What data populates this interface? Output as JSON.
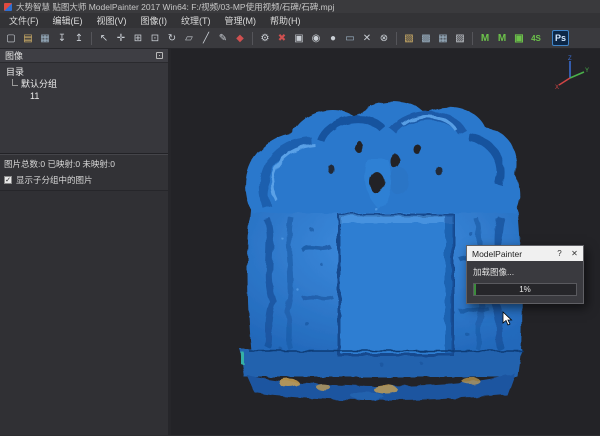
{
  "window": {
    "title": "大势智慧 贴图大师 ModelPainter 2017 Win64: F:/视频/03-MP使用视频/石碑/石碑.mpj"
  },
  "menu": {
    "items": [
      {
        "label": "文件(F)"
      },
      {
        "label": "编辑(E)"
      },
      {
        "label": "视图(V)"
      },
      {
        "label": "图像(I)"
      },
      {
        "label": "纹理(T)"
      },
      {
        "label": "管理(M)"
      },
      {
        "label": "帮助(H)"
      }
    ]
  },
  "toolbar": {
    "icons": [
      {
        "name": "new-file-icon",
        "glyph": "▢"
      },
      {
        "name": "open-folder-icon",
        "glyph": "▤"
      },
      {
        "name": "save-icon",
        "glyph": "▦"
      },
      {
        "name": "import-image-icon",
        "glyph": "↧"
      },
      {
        "name": "export-image-icon",
        "glyph": "↥"
      },
      {
        "name": "select-arrow-icon",
        "glyph": "↖"
      },
      {
        "name": "pan-icon",
        "glyph": "✛"
      },
      {
        "name": "zoom-window-icon",
        "glyph": "⊞"
      },
      {
        "name": "zoom-fit-icon",
        "glyph": "⊡"
      },
      {
        "name": "rotate-view-icon",
        "glyph": "↻"
      },
      {
        "name": "region-select-icon",
        "glyph": "▱"
      },
      {
        "name": "line-tool-icon",
        "glyph": "╱"
      },
      {
        "name": "draw-tool-icon",
        "glyph": "✎"
      },
      {
        "name": "marker-tool-icon",
        "glyph": "◆"
      },
      {
        "name": "settings-gear-icon",
        "glyph": "⚙"
      },
      {
        "name": "delete-icon",
        "glyph": "✖"
      },
      {
        "name": "snapshot-camera-icon",
        "glyph": "▣"
      },
      {
        "name": "record-camera-icon",
        "glyph": "◉"
      },
      {
        "name": "material-sphere-icon",
        "glyph": "●"
      },
      {
        "name": "monitor-icon",
        "glyph": "▭"
      },
      {
        "name": "close-tool-icon",
        "glyph": "✕"
      },
      {
        "name": "remove-circle-icon",
        "glyph": "⊗"
      },
      {
        "name": "box-projection-icon",
        "glyph": "▧"
      },
      {
        "name": "cube-map-icon",
        "glyph": "▩"
      },
      {
        "name": "mesh-grid-icon",
        "glyph": "▦"
      },
      {
        "name": "texture-swatch-icon",
        "glyph": "▨"
      },
      {
        "name": "map-texture-icon",
        "glyph": "M"
      },
      {
        "name": "map-texture-alt-icon",
        "glyph": "M"
      },
      {
        "name": "texture-camera-icon",
        "glyph": "▣"
      },
      {
        "name": "s4-tool-icon",
        "glyph": "4S"
      },
      {
        "name": "photoshop-icon",
        "glyph": "Ps"
      }
    ]
  },
  "sidebar": {
    "title": "图像",
    "tree_rows": [
      {
        "label": "目录"
      },
      {
        "label": "默认分组"
      },
      {
        "label": "11"
      }
    ],
    "stats": "图片总数:0 已映射:0 未映射:0",
    "checkbox_label": "显示子分组中的图片",
    "checkbox_checked": true,
    "checkbox_glyph": "✓"
  },
  "viewport": {
    "axis": {
      "x": "X",
      "y": "Y",
      "z": "Z"
    }
  },
  "dialog": {
    "title": "ModelPainter",
    "help_label": "?",
    "close_label": "✕",
    "message": "加载图像...",
    "progress_text": "1%",
    "progress_percent": 1
  },
  "colors": {
    "model_blue": "#2b78cc",
    "model_shadow": "#17519a",
    "model_highlight": "#5fa5ea",
    "viewport_background": "#232327",
    "base_tan": "#c9a050",
    "base_teal": "#35b0a6",
    "progress_green": "#3c8c3c",
    "photoshop_blue": "#0d2746",
    "axis_x_color": "#d04545",
    "axis_y_color": "#4ab04a",
    "axis_z_color": "#3a6fd8"
  }
}
